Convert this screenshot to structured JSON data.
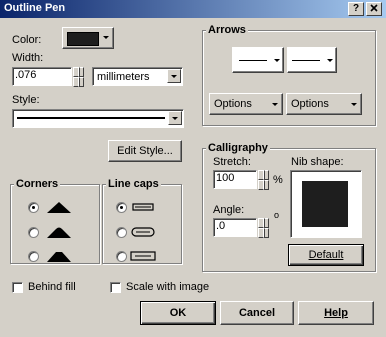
{
  "window": {
    "title": "Outline Pen",
    "help_button": "?",
    "close_button": "x"
  },
  "color": {
    "label": "Color:",
    "swatch": "#1e1e1e"
  },
  "width": {
    "label": "Width:",
    "value": ".076",
    "unit": "millimeters"
  },
  "style": {
    "label": "Style:"
  },
  "edit_style_button": "Edit Style...",
  "corners": {
    "title": "Corners"
  },
  "line_caps": {
    "title": "Line caps"
  },
  "arrows": {
    "title": "Arrows",
    "options_left": "Options",
    "options_right": "Options"
  },
  "calligraphy": {
    "title": "Calligraphy",
    "stretch_label": "Stretch:",
    "stretch_value": "100",
    "stretch_unit": "%",
    "angle_label": "Angle:",
    "angle_value": ".0",
    "angle_unit": "o",
    "nib_label": "Nib shape:",
    "nib_color": "#1e1e1e",
    "default_button": "Default"
  },
  "behind_fill": "Behind fill",
  "scale_with_image": "Scale with image",
  "buttons": {
    "ok": "OK",
    "cancel": "Cancel",
    "help": "Help"
  }
}
